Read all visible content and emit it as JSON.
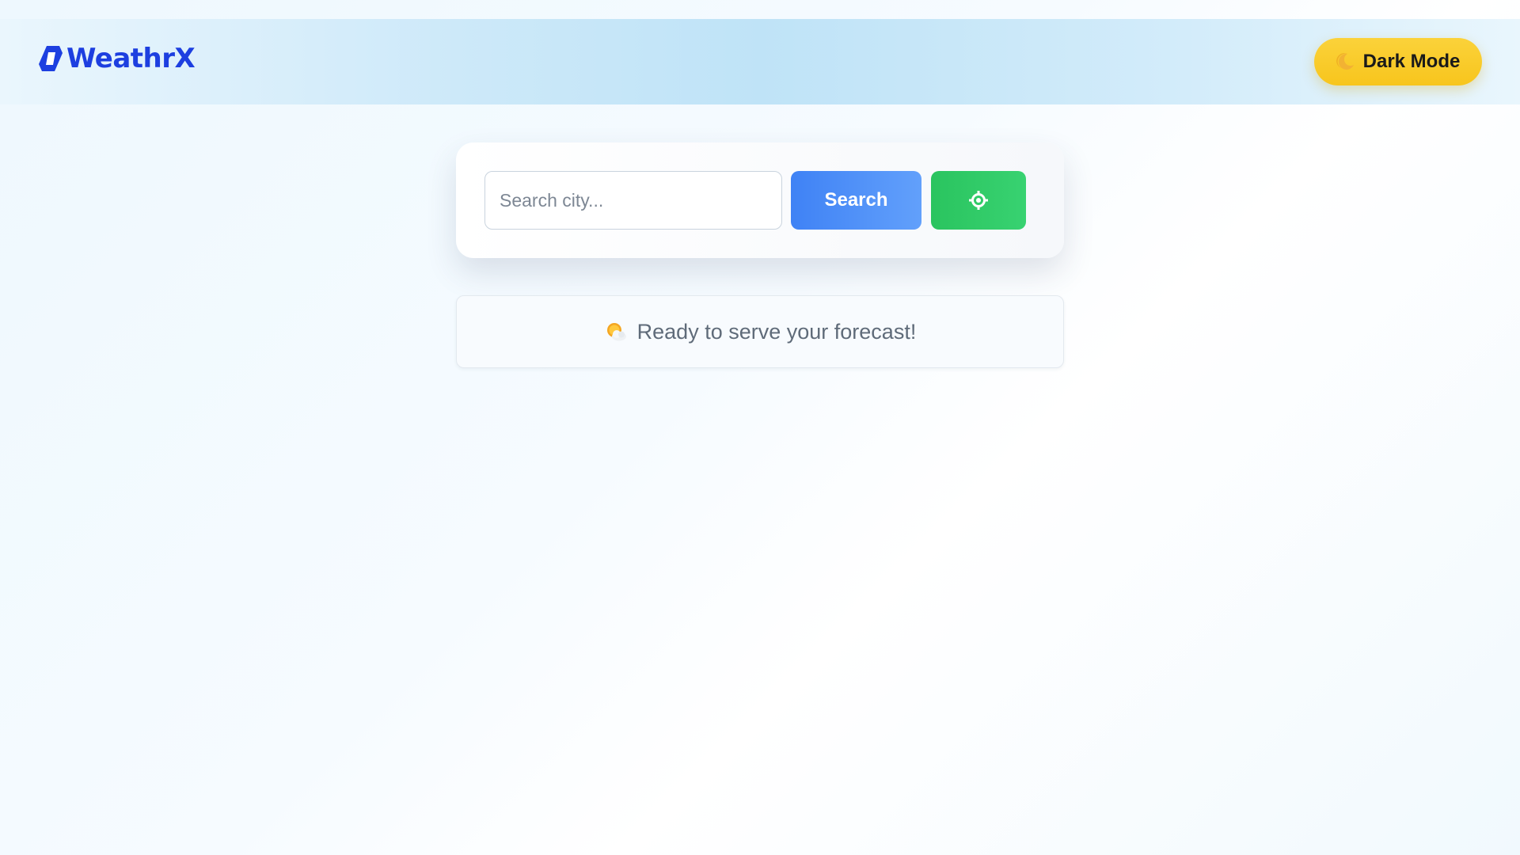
{
  "app": {
    "logo_text": "WeathrX",
    "brand_color": "#1d3fe0",
    "logo_icon": "bolt-hex-icon"
  },
  "header": {
    "mode_toggle": {
      "label": "Dark Mode",
      "icon": "moon-icon",
      "color": "#f9cb2a"
    }
  },
  "search": {
    "placeholder": "Search city...",
    "value": "",
    "button_label": "Search",
    "button_color": "#4a8cf7",
    "locate_icon": "location-crosshair-icon",
    "locate_color": "#2ecc66"
  },
  "status": {
    "icon": "sun-behind-cloud-icon",
    "message": "Ready to serve your forecast!"
  }
}
